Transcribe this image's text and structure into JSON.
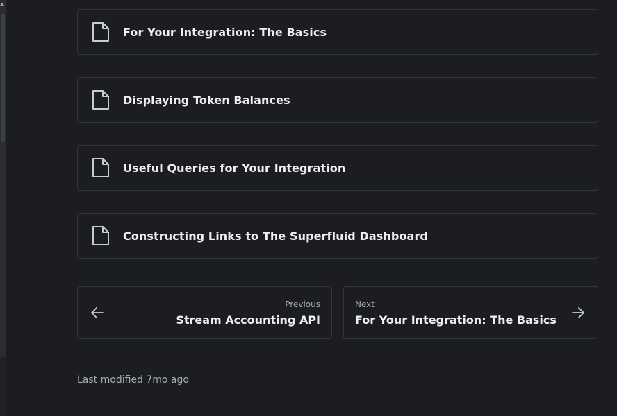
{
  "pages": [
    {
      "label": "For Your Integration: The Basics",
      "icon": "document-icon"
    },
    {
      "label": "Displaying Token Balances",
      "icon": "document-icon"
    },
    {
      "label": "Useful Queries for Your Integration",
      "icon": "document-icon"
    },
    {
      "label": "Constructing Links to The Superfluid Dashboard",
      "icon": "document-icon"
    }
  ],
  "pagination": {
    "previous": {
      "caption": "Previous",
      "title": "Stream Accounting API",
      "icon": "arrow-left-icon"
    },
    "next": {
      "caption": "Next",
      "title": "For Your Integration: The Basics",
      "icon": "arrow-right-icon"
    }
  },
  "footer": {
    "last_modified": "Last modified 7mo ago"
  },
  "colors": {
    "background": "#1b1d20",
    "border": "#33363b",
    "text": "#eceef0",
    "muted": "#a6abb1"
  }
}
